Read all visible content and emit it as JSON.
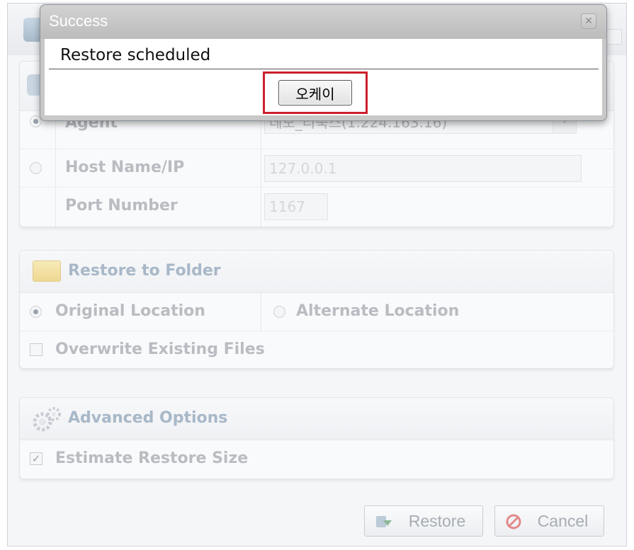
{
  "connection": {
    "agent_label": "Agent",
    "agent_value": "데모_리눅스(1.224.163.16)",
    "host_label": "Host Name/IP",
    "host_value": "127.0.0.1",
    "port_label": "Port Number",
    "port_value": "1167"
  },
  "restore_to_folder": {
    "title": "Restore to Folder",
    "original_label": "Original Location",
    "alternate_label": "Alternate Location",
    "overwrite_label": "Overwrite Existing Files"
  },
  "advanced": {
    "title": "Advanced Options",
    "estimate_label": "Estimate Restore Size",
    "estimate_mark": "✓"
  },
  "footer": {
    "restore_label": "Restore",
    "cancel_label": "Cancel"
  },
  "dialog": {
    "title": "Success",
    "close_glyph": "✕",
    "message": "Restore scheduled",
    "ok_label": "오케이",
    "highlight_color": "#cc1f2d"
  }
}
